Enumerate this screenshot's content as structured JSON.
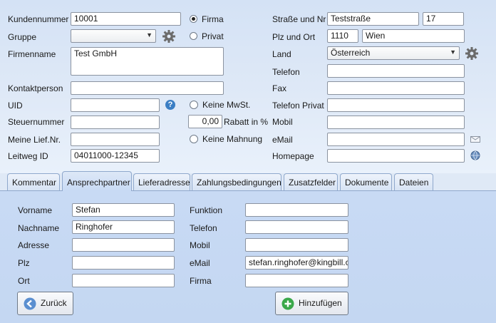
{
  "customer": {
    "kundennummer_label": "Kundennummer",
    "kundennummer": "10001",
    "gruppe_label": "Gruppe",
    "gruppe": "",
    "firmenname_label": "Firmenname",
    "firmenname": "Test GmbH",
    "kontaktperson_label": "Kontaktperson",
    "kontaktperson": "",
    "uid_label": "UID",
    "uid": "",
    "steuernummer_label": "Steuernummer",
    "steuernummer": "",
    "lief_label": "Meine Lief.Nr.",
    "lief": "",
    "leitweg_label": "Leitweg ID",
    "leitweg": "04011000-12345",
    "firma_label": "Firma",
    "privat_label": "Privat",
    "type_selected": "Firma",
    "keine_mwst_label": "Keine MwSt.",
    "rabatt_value": "0,00",
    "rabatt_label": "Rabatt in %",
    "keine_mahnung_label": "Keine Mahnung",
    "strasse_label": "Straße und Nr",
    "strasse": "Teststraße",
    "hausnr": "17",
    "plz_label": "Plz und Ort",
    "plz": "1110",
    "ort": "Wien",
    "land_label": "Land",
    "land": "Österreich",
    "telefon_label": "Telefon",
    "telefon": "",
    "fax_label": "Fax",
    "fax": "",
    "telefon_privat_label": "Telefon Privat",
    "telefon_privat": "",
    "mobil_label": "Mobil",
    "mobil": "",
    "email_label": "eMail",
    "email": "",
    "homepage_label": "Homepage",
    "homepage": ""
  },
  "tabs": [
    {
      "label": "Kommentar"
    },
    {
      "label": "Ansprechpartner",
      "active": true
    },
    {
      "label": "Lieferadresse"
    },
    {
      "label": "Zahlungsbedingungen"
    },
    {
      "label": "Zusatzfelder"
    },
    {
      "label": "Dokumente"
    },
    {
      "label": "Dateien"
    }
  ],
  "contact": {
    "vorname_label": "Vorname",
    "vorname": "Stefan",
    "nachname_label": "Nachname",
    "nachname": "Ringhofer",
    "adresse_label": "Adresse",
    "adresse": "",
    "plz_label": "Plz",
    "plz": "",
    "ort_label": "Ort",
    "ort": "",
    "funktion_label": "Funktion",
    "funktion": "",
    "telefon_label": "Telefon",
    "telefon": "",
    "mobil_label": "Mobil",
    "mobil": "",
    "email_label": "eMail",
    "email": "stefan.ringhofer@kingbill.com",
    "firma_label": "Firma",
    "firma": "",
    "back_button": "Zurück",
    "add_button": "Hinzufügen"
  },
  "colors": {
    "accent": "#3b7ec4",
    "add_green": "#3aa84a",
    "back_blue": "#5b8fd0"
  }
}
